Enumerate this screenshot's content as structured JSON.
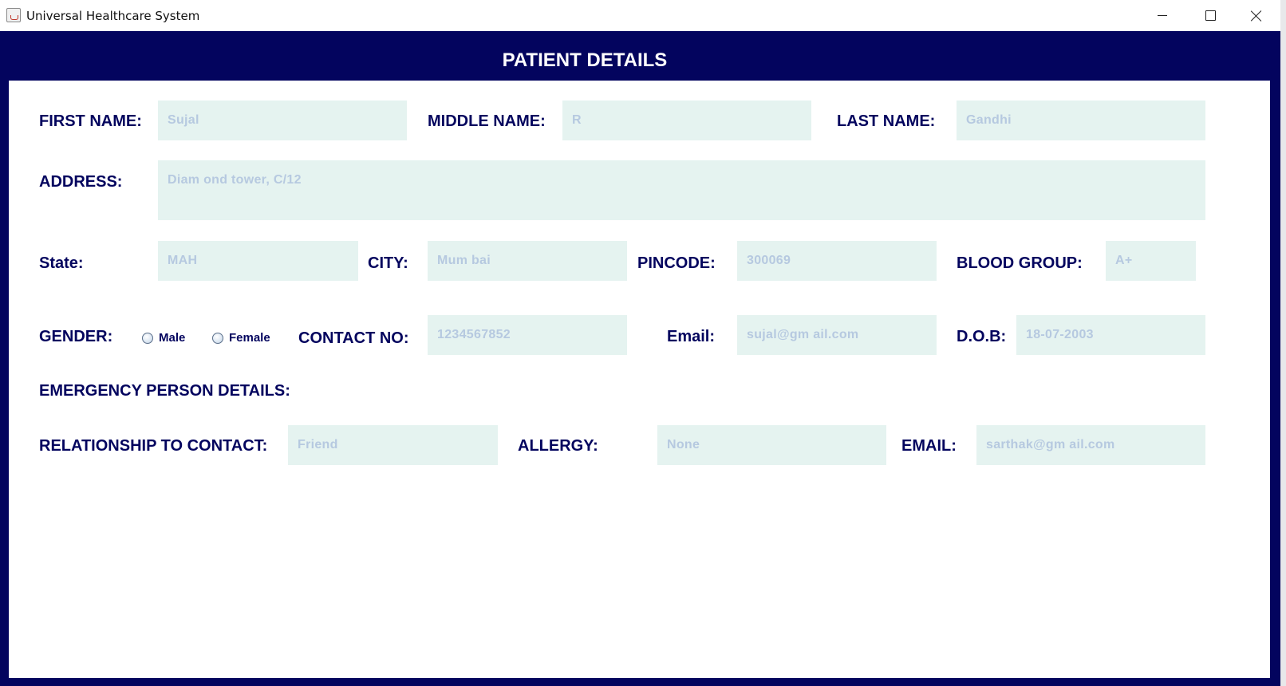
{
  "window": {
    "title": "Universal Healthcare System"
  },
  "header": {
    "title": "PATIENT DETAILS"
  },
  "form": {
    "first_name": {
      "label": "FIRST NAME:",
      "value": "Sujal"
    },
    "middle_name": {
      "label": "MIDDLE NAME:",
      "value": "R"
    },
    "last_name": {
      "label": "LAST NAME:",
      "value": "Gandhi"
    },
    "address": {
      "label": "ADDRESS:",
      "value": "Diam ond tower, C/12"
    },
    "state": {
      "label": "State:",
      "value": "MAH"
    },
    "city": {
      "label": "CITY:",
      "value": "Mum bai"
    },
    "pincode": {
      "label": "PINCODE:",
      "value": "300069"
    },
    "blood_group": {
      "label": "BLOOD GROUP:",
      "value": "A+"
    },
    "gender": {
      "label": "GENDER:",
      "options": [
        "Male",
        "Female"
      ]
    },
    "contact_no": {
      "label": "CONTACT NO:",
      "value": "1234567852"
    },
    "email": {
      "label": "Email:",
      "value": "sujal@gm ail.com"
    },
    "dob": {
      "label": "D.O.B:",
      "value": "18-07-2003"
    },
    "emergency_heading": "EMERGENCY PERSON DETAILS:",
    "relationship": {
      "label": "RELATIONSHIP TO CONTACT:",
      "value": "Friend"
    },
    "allergy": {
      "label": "ALLERGY:",
      "value": "None"
    },
    "emergency_email": {
      "label": "EMAIL:",
      "value": "sarthak@gm ail.com"
    }
  },
  "colors": {
    "navy": "#03045e",
    "field_bg": "#e5f3f0",
    "field_text": "#b6c9e0"
  },
  "icons": {
    "app": "java-cup-icon",
    "minimize": "minimize-icon",
    "maximize": "maximize-icon",
    "close": "close-icon"
  }
}
